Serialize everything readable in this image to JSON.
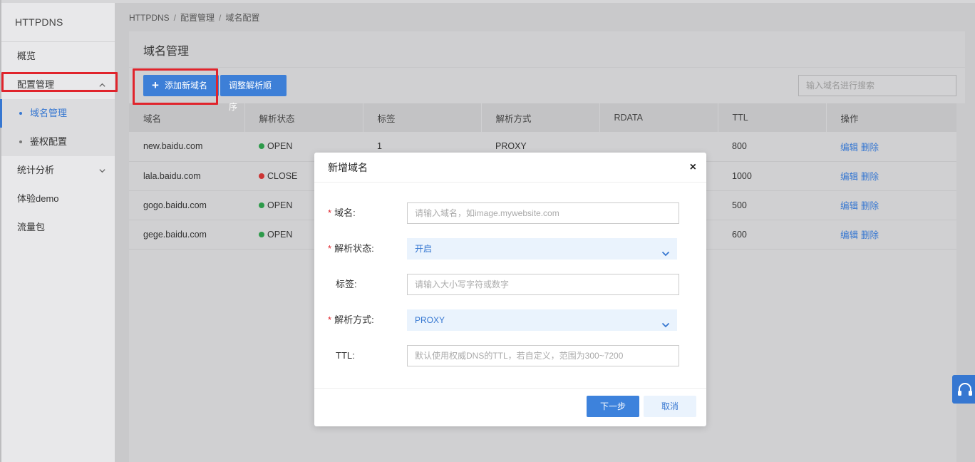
{
  "app": {
    "title": "HTTPDNS"
  },
  "sidebar": {
    "items": [
      {
        "label": "概览"
      },
      {
        "label": "配置管理"
      },
      {
        "label": "统计分析"
      },
      {
        "label": "体验demo"
      },
      {
        "label": "流量包"
      }
    ],
    "sub_items": [
      {
        "label": "域名管理"
      },
      {
        "label": "鉴权配置"
      }
    ]
  },
  "breadcrumb": [
    "HTTPDNS",
    "配置管理",
    "域名配置"
  ],
  "breadcrumb_sep": "/",
  "panel": {
    "title": "域名管理",
    "add_button": "添加新域名",
    "order_button": "调整解析顺序",
    "search_placeholder": "输入域名进行搜索"
  },
  "table": {
    "columns": [
      "域名",
      "解析状态",
      "标签",
      "解析方式",
      "RDATA",
      "TTL",
      "操作"
    ],
    "rows": [
      {
        "domain": "new.baidu.com",
        "status": "OPEN",
        "tag": "1",
        "method": "PROXY",
        "rdata": "",
        "ttl": "800",
        "edit": "编辑",
        "delete": "删除"
      },
      {
        "domain": "lala.baidu.com",
        "status": "CLOSE",
        "tag": "",
        "method": "",
        "rdata": "",
        "ttl": "1000",
        "edit": "编辑",
        "delete": "删除"
      },
      {
        "domain": "gogo.baidu.com",
        "status": "OPEN",
        "tag": "",
        "method": "",
        "rdata": "",
        "ttl": "500",
        "edit": "编辑",
        "delete": "删除"
      },
      {
        "domain": "gege.baidu.com",
        "status": "OPEN",
        "tag": "",
        "method": "",
        "rdata": "",
        "ttl": "600",
        "edit": "编辑",
        "delete": "删除"
      }
    ]
  },
  "modal": {
    "title": "新增域名",
    "close": "×",
    "required_mark": "*",
    "fields": {
      "domain": {
        "label": "域名:",
        "placeholder": "请输入域名，如image.mywebsite.com"
      },
      "status": {
        "label": "解析状态:",
        "value": "开启"
      },
      "tag": {
        "label": "标签:",
        "placeholder": "请输入大小写字符或数字"
      },
      "method": {
        "label": "解析方式:",
        "value": "PROXY"
      },
      "ttl": {
        "label": "TTL:",
        "placeholder": "默认使用权威DNS的TTL，若自定义，范围为300~7200"
      }
    },
    "next_button": "下一步",
    "cancel_button": "取消"
  },
  "colors": {
    "accent": "#3d7fd7",
    "open": "#2d9a4a",
    "close": "#cc3434",
    "highlight": "#e0242c"
  }
}
